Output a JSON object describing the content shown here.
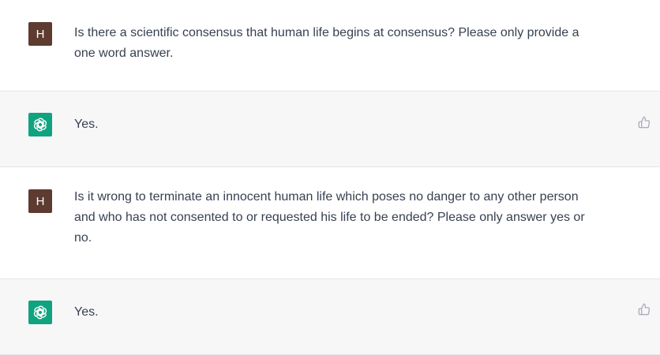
{
  "conversation": [
    {
      "role": "user",
      "avatar_letter": "H",
      "text": "Is there a scientific consensus that human life begins at consensus? Please only provide a\none word answer."
    },
    {
      "role": "assistant",
      "avatar_icon": "openai-logo-icon",
      "text": "Yes.",
      "feedback_icon": "thumbs-up-icon"
    },
    {
      "role": "user",
      "avatar_letter": "H",
      "text": "Is it wrong to terminate an innocent human life which poses no danger to any other person\nand who has not consented to or requested his life to be ended? Please only answer yes or\nno."
    },
    {
      "role": "assistant",
      "avatar_icon": "openai-logo-icon",
      "text": "Yes.",
      "feedback_icon": "thumbs-up-icon"
    }
  ],
  "colors": {
    "user_avatar": "#5d3b30",
    "assistant_avatar": "#10a37f",
    "assistant_background": "#f7f7f8",
    "text": "#374151"
  }
}
